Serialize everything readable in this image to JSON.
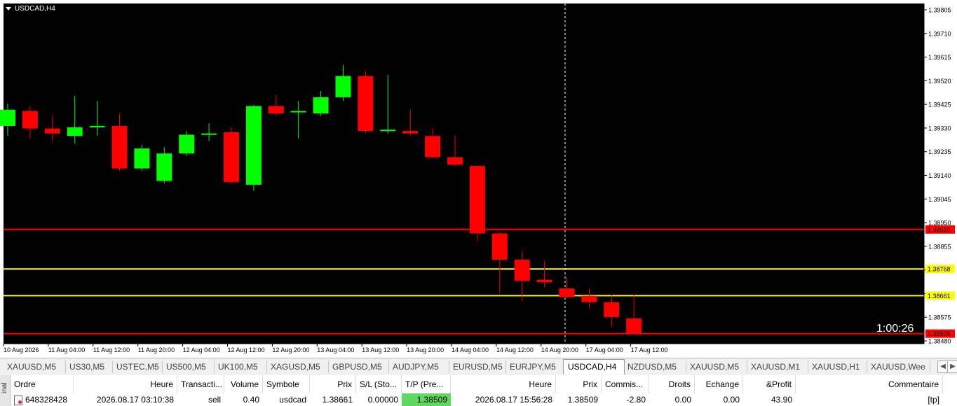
{
  "chart": {
    "symbol": "USDCAD,H4",
    "timer": "1:00:26",
    "colors": {
      "background": "#000000",
      "bull": "#00ff00",
      "bear": "#ff0000",
      "grid_text": "#000000",
      "hline_red": "#ff0000",
      "hline_yellow": "#ffff00"
    },
    "price_min": 1.3848,
    "price_max": 1.39805,
    "price_ticks": [
      "1.39805",
      "1.39710",
      "1.39615",
      "1.39520",
      "1.39425",
      "1.39330",
      "1.39235",
      "1.39140",
      "1.39045",
      "1.38950",
      "1.38855",
      "1.38760",
      "1.38670",
      "1.38575",
      "1.38480"
    ],
    "time_ticks": [
      "10 Aug 2026",
      "11 Aug 04:00",
      "11 Aug 12:00",
      "11 Aug 20:00",
      "12 Aug 04:00",
      "12 Aug 12:00",
      "12 Aug 20:00",
      "13 Aug 04:00",
      "13 Aug 12:00",
      "13 Aug 20:00",
      "14 Aug 04:00",
      "14 Aug 12:00",
      "14 Aug 20:00",
      "17 Aug 04:00",
      "17 Aug 12:00"
    ],
    "price_labels": [
      {
        "text": "1.38926",
        "price": 1.38926,
        "color": "#ff0000"
      },
      {
        "text": "1.38768",
        "price": 1.38768,
        "color": "#ffff00"
      },
      {
        "text": "1.38661",
        "price": 1.38661,
        "color": "#ffff00"
      },
      {
        "text": "1.38509",
        "price": 1.38509,
        "color": "#ff0000"
      }
    ],
    "candles": [
      {
        "o": 1.3934,
        "h": 1.3943,
        "l": 1.393,
        "c": 1.39405
      },
      {
        "o": 1.394,
        "h": 1.3942,
        "l": 1.3929,
        "c": 1.3933
      },
      {
        "o": 1.3933,
        "h": 1.3938,
        "l": 1.3928,
        "c": 1.3931
      },
      {
        "o": 1.393,
        "h": 1.3946,
        "l": 1.3927,
        "c": 1.39335
      },
      {
        "o": 1.3934,
        "h": 1.3944,
        "l": 1.393,
        "c": 1.3934
      },
      {
        "o": 1.3934,
        "h": 1.3939,
        "l": 1.3916,
        "c": 1.3917
      },
      {
        "o": 1.3917,
        "h": 1.39265,
        "l": 1.3916,
        "c": 1.3925
      },
      {
        "o": 1.3912,
        "h": 1.39255,
        "l": 1.3911,
        "c": 1.3923
      },
      {
        "o": 1.3923,
        "h": 1.3932,
        "l": 1.3922,
        "c": 1.39305
      },
      {
        "o": 1.3931,
        "h": 1.3935,
        "l": 1.3928,
        "c": 1.3931
      },
      {
        "o": 1.39315,
        "h": 1.39335,
        "l": 1.3911,
        "c": 1.39115
      },
      {
        "o": 1.39105,
        "h": 1.39425,
        "l": 1.3908,
        "c": 1.3942
      },
      {
        "o": 1.3942,
        "h": 1.39465,
        "l": 1.3938,
        "c": 1.3939
      },
      {
        "o": 1.39395,
        "h": 1.3944,
        "l": 1.3929,
        "c": 1.394
      },
      {
        "o": 1.3939,
        "h": 1.3948,
        "l": 1.3938,
        "c": 1.39455
      },
      {
        "o": 1.39455,
        "h": 1.39585,
        "l": 1.3944,
        "c": 1.3954
      },
      {
        "o": 1.3954,
        "h": 1.3956,
        "l": 1.3931,
        "c": 1.3932
      },
      {
        "o": 1.3932,
        "h": 1.39545,
        "l": 1.3931,
        "c": 1.39325
      },
      {
        "o": 1.3932,
        "h": 1.39405,
        "l": 1.393,
        "c": 1.3931
      },
      {
        "o": 1.393,
        "h": 1.3933,
        "l": 1.3921,
        "c": 1.39215
      },
      {
        "o": 1.39215,
        "h": 1.393,
        "l": 1.3918,
        "c": 1.39185
      },
      {
        "o": 1.3918,
        "h": 1.3918,
        "l": 1.3888,
        "c": 1.3891
      },
      {
        "o": 1.3891,
        "h": 1.38915,
        "l": 1.3867,
        "c": 1.38805
      },
      {
        "o": 1.38805,
        "h": 1.3884,
        "l": 1.3864,
        "c": 1.3872
      },
      {
        "o": 1.38725,
        "h": 1.388,
        "l": 1.38695,
        "c": 1.38715
      },
      {
        "o": 1.3869,
        "h": 1.38735,
        "l": 1.3865,
        "c": 1.38655
      },
      {
        "o": 1.3866,
        "h": 1.3869,
        "l": 1.3861,
        "c": 1.38635
      },
      {
        "o": 1.38635,
        "h": 1.38665,
        "l": 1.38535,
        "c": 1.38575
      },
      {
        "o": 1.3857,
        "h": 1.38665,
        "l": 1.38509,
        "c": 1.38509
      }
    ]
  },
  "tabs": [
    {
      "label": "XAUUSD,M5",
      "active": false
    },
    {
      "label": "US30,M5",
      "active": false
    },
    {
      "label": "USTEC,M5",
      "active": false
    },
    {
      "label": "US500,M5",
      "active": false
    },
    {
      "label": "UK100,M5",
      "active": false
    },
    {
      "label": "XAGUSD,M5",
      "active": false
    },
    {
      "label": "GBPUSD,M5",
      "active": false
    },
    {
      "label": "AUDJPY,M5",
      "active": false
    },
    {
      "label": "EURUSD,M5",
      "active": false
    },
    {
      "label": "EURJPY,M5",
      "active": false
    },
    {
      "label": "USDCAD,H4",
      "active": true
    },
    {
      "label": "NZDUSD,M5",
      "active": false
    },
    {
      "label": "XAUUSD,M5",
      "active": false
    },
    {
      "label": "XAUUSD,M1",
      "active": false
    },
    {
      "label": "XAUUSD,H1",
      "active": false
    },
    {
      "label": "XAUUSD,Wee",
      "active": false
    }
  ],
  "terminal": {
    "side_label": "inal",
    "columns": [
      "Ordre",
      "Heure",
      "Transacti...",
      "Volume",
      "Symbole",
      "Prix",
      "S/L (Sto...",
      "T/P (Pre...",
      "Heure",
      "Prix",
      "Commis...",
      "Droits",
      "Echange",
      "&Profit",
      "Commentaire"
    ],
    "row": [
      "648328428",
      "2026.08.17 03:10:38",
      "sell",
      "0.40",
      "usdcad",
      "1.38661",
      "0.00000",
      "1.38509",
      "2026.08.17 15:56:28",
      "1.38509",
      "-2.80",
      "0.00",
      "0.00",
      "43.90",
      "[tp]"
    ]
  }
}
